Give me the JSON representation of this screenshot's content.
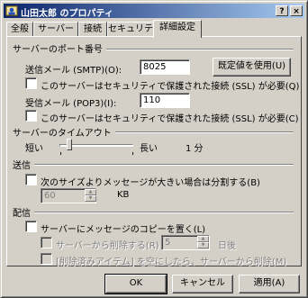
{
  "window": {
    "title": "山田太郎 のプロパティ",
    "help_label": "?",
    "close_label": "×"
  },
  "tabs": [
    "全般",
    "サーバー",
    "接続",
    "セキュリティ",
    "詳細設定"
  ],
  "active_tab": 4,
  "server_ports": {
    "title": "サーバーのポート番号",
    "smtp_label": "送信メール (SMTP)(O):",
    "smtp_value": "8025",
    "default_button": "既定値を使用(U)",
    "smtp_ssl_label": "このサーバーはセキュリティで保護された接続 (SSL) が必要(Q)",
    "pop3_label": "受信メール (POP3)(I):",
    "pop3_value": "110",
    "pop3_ssl_label": "このサーバーはセキュリティで保護された接続 (SSL) が必要(C)"
  },
  "timeout": {
    "title": "サーバーのタイムアウト",
    "short_label": "短い",
    "long_label": "長い",
    "value_label": "1 分",
    "level": 0.1
  },
  "sending": {
    "title": "送信",
    "split_label": "次のサイズよりメッセージが大きい場合は分割する(B)",
    "size_value": "60",
    "unit_label": "KB"
  },
  "delivery": {
    "title": "配信",
    "leave_copy_label": "サーバーにメッセージのコピーを置く(L)",
    "remove_after_label": "サーバーから削除する(R)",
    "remove_days_value": "5",
    "days_unit_label": "日後",
    "remove_deleted_label": "[削除済みアイテム] を空にしたら、サーバーから削除(M)"
  },
  "buttons": {
    "ok": "OK",
    "cancel": "キャンセル",
    "apply": "適用(A)"
  }
}
